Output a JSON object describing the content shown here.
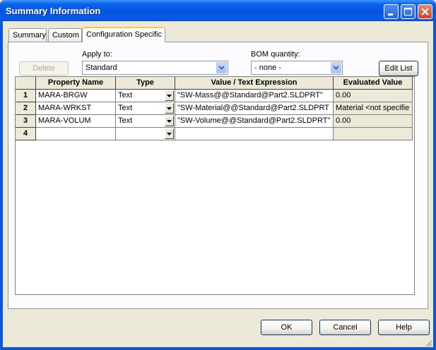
{
  "window": {
    "title": "Summary Information",
    "controls": {
      "minimize": "minimize-icon",
      "maximize": "maximize-icon",
      "close": "close-icon"
    }
  },
  "tabs": [
    {
      "label": "Summary"
    },
    {
      "label": "Custom"
    },
    {
      "label": "Configuration Specific",
      "active": true
    }
  ],
  "toolbar": {
    "delete_label": "Delete",
    "apply_to_label": "Apply to:",
    "apply_to_value": "Standard",
    "bom_label": "BOM quantity:",
    "bom_value": "- none -",
    "edit_list_label": "Edit List"
  },
  "grid": {
    "columns": [
      "Property Name",
      "Type",
      "Value / Text Expression",
      "Evaluated Value"
    ],
    "rows": [
      {
        "num": "1",
        "name": "MARA-BRGW",
        "type": "Text",
        "value": "\"SW-Mass@@Standard@Part2.SLDPRT\"",
        "evaluated": "0.00"
      },
      {
        "num": "2",
        "name": "MARA-WRKST",
        "type": "Text",
        "value": "\"SW-Material@@Standard@Part2.SLDPRT",
        "evaluated": "Material <not specifie"
      },
      {
        "num": "3",
        "name": "MARA-VOLUM",
        "type": "Text",
        "value": "\"SW-Volume@@Standard@Part2.SLDPRT\"",
        "evaluated": "0.00"
      },
      {
        "num": "4",
        "name": "",
        "type": "",
        "value": "",
        "evaluated": ""
      }
    ]
  },
  "footer": {
    "ok_label": "OK",
    "cancel_label": "Cancel",
    "help_label": "Help"
  },
  "colors": {
    "title_bar": "#0a5ae8",
    "dialog_bg": "#ece9d8",
    "tab_highlight": "#ffc83c"
  }
}
